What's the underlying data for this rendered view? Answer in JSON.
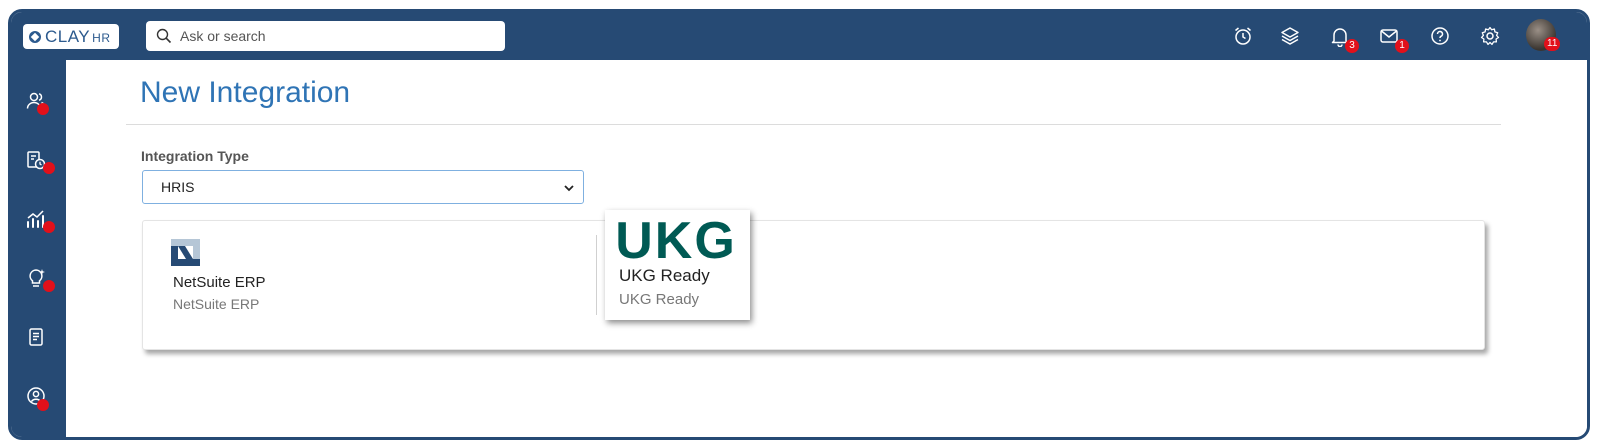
{
  "app": {
    "logo_text": "CLAY",
    "logo_suffix": "HR"
  },
  "search": {
    "placeholder": "Ask or search"
  },
  "topbar": {
    "icons": [
      "alarm-clock-icon",
      "layers-icon",
      "bell-icon",
      "mail-icon",
      "help-icon",
      "gear-icon",
      "avatar"
    ],
    "notifications_count": "3",
    "messages_count": "1",
    "avatar_badge": "11"
  },
  "sidebar": {
    "items": [
      "people-icon",
      "report-clock-icon",
      "analytics-icon",
      "lightbulb-icon",
      "documents-icon",
      "user-circle-icon"
    ]
  },
  "page": {
    "title": "New Integration",
    "integration_type_label": "Integration Type",
    "integration_type_value": "HRIS"
  },
  "integrations": [
    {
      "name": "NetSuite ERP",
      "subtitle": "NetSuite ERP",
      "logo": "netsuite-logo"
    },
    {
      "name": "UKG Ready",
      "subtitle": "UKG Ready",
      "logo": "ukg-logo",
      "logo_text": "UKG"
    }
  ],
  "colors": {
    "nav": "#264a74",
    "title": "#2f74b5",
    "badge": "#e2101a",
    "ukg_green": "#005a54"
  }
}
